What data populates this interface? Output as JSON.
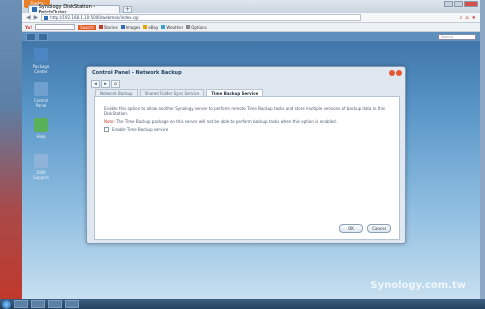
{
  "browser": {
    "menu_button": "Firefox",
    "tab_title": "Synology DiskStation - FetchOuter",
    "new_tab": "+",
    "url": "http://192.168.1.10:5000/webman/index.cgi",
    "toolbar": {
      "logo": "Yo!",
      "search_button": "Search",
      "items": [
        "Stories",
        "Images",
        "eBay",
        "Weather",
        "Options"
      ]
    }
  },
  "dsm": {
    "search_placeholder": "Search",
    "desktop_icons": [
      "Package Center",
      "Control Panel",
      "Help",
      "DSM Support"
    ],
    "watermark": "Synology.com.tw"
  },
  "dialog": {
    "title": "Control Panel - Network Backup",
    "tabs": [
      {
        "label": "Network Backup"
      },
      {
        "label": "Shared Folder Sync Service"
      },
      {
        "label": "Time Backup Service"
      }
    ],
    "description": "Enable this option to allow another Synology server to perform remote Time Backup tasks and store multiple versions of backup data in this DiskStation.",
    "note_label": "Note:",
    "note_text": "The Time Backup package on this server will not be able to perform backup tasks when this option is enabled.",
    "checkbox_label": "Enable Time Backup service",
    "ok_label": "OK",
    "cancel_label": "Cancel"
  },
  "colors": {
    "accent": "#2f6db3",
    "note_red": "#c0392b",
    "desktop_blue": "#3c72a7"
  }
}
